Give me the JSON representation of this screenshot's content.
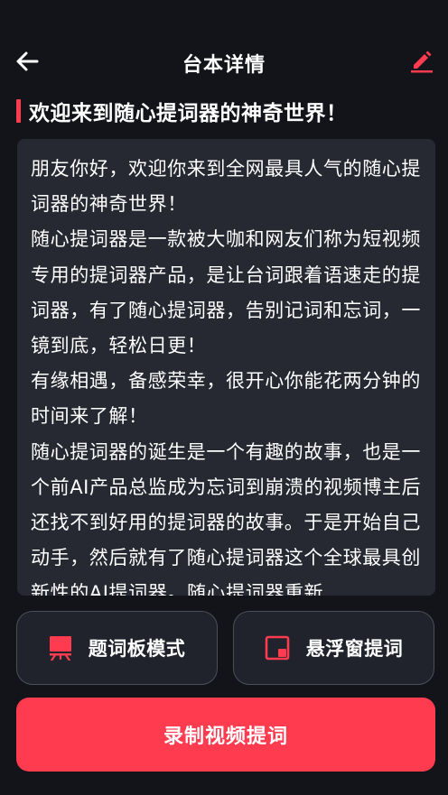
{
  "header": {
    "title": "台本详情",
    "back_icon": "arrow-left-icon",
    "edit_icon": "pencil-icon"
  },
  "script": {
    "title": "欢迎来到随心提词器的神奇世界！",
    "paragraphs": [
      "朋友你好，欢迎你来到全网最具人气的随心提词器的神奇世界！",
      "随心提词器是一款被大咖和网友们称为短视频专用的提词器产品，是让台词跟着语速走的提词器，有了随心提词器，告别记词和忘词，一镜到底，轻松日更！",
      "有缘相遇，备感荣幸，很开心你能花两分钟的时间来了解！",
      "随心提词器的诞生是一个有趣的故事，也是一个前AI产品总监成为忘词到崩溃的视频博主后还找不到好用的提词器的故事。于是开始自己动手，然后就有了随心提词器这个全球最具创新性的AI提词器。随心提词器重新"
    ]
  },
  "actions": {
    "teleprompter_mode": "题词板模式",
    "floating_window": "悬浮窗提词",
    "record_video": "录制视频提词"
  },
  "colors": {
    "background": "#121419",
    "card": "#262931",
    "accent": "#ff3b50",
    "button_border": "#4a4f5b"
  }
}
